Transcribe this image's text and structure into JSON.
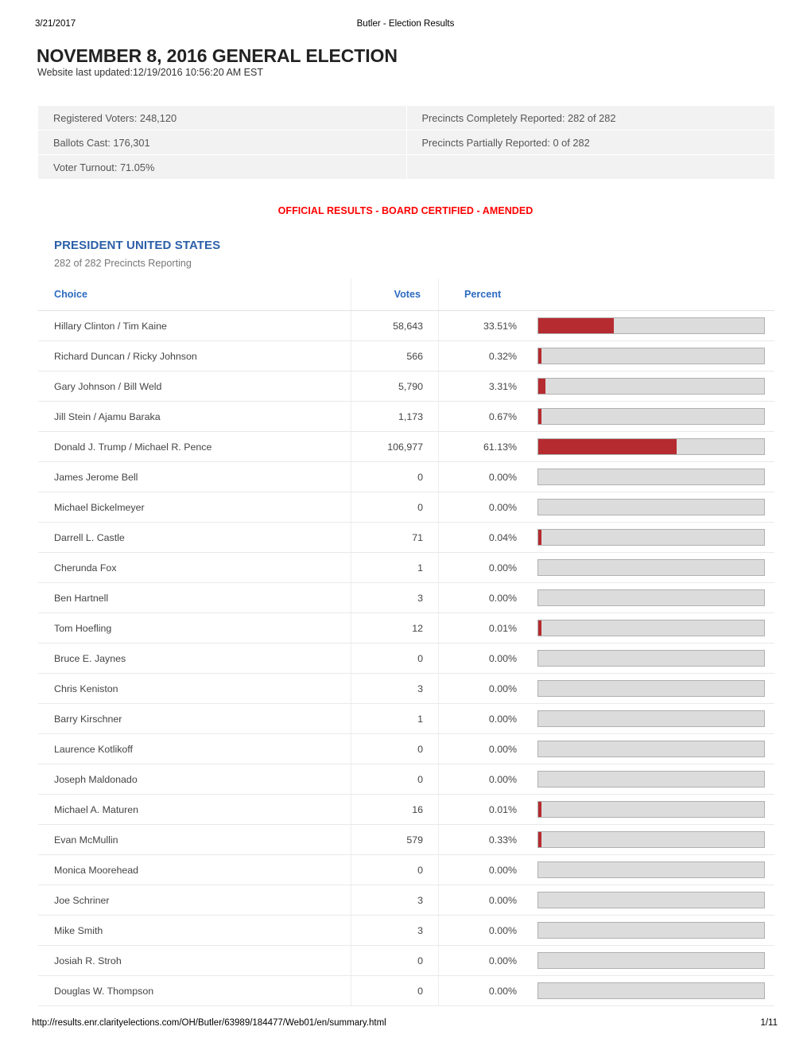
{
  "print_header": {
    "date": "3/21/2017",
    "title": "Butler - Election Results"
  },
  "document": {
    "title": "NOVEMBER 8, 2016 GENERAL ELECTION",
    "last_updated": "Website last updated:12/19/2016 10:56:20 AM EST"
  },
  "summary": {
    "cells": [
      "Registered Voters: 248,120",
      "Precincts Completely Reported: 282 of 282",
      "Ballots Cast: 176,301",
      "Precincts Partially Reported: 0 of 282",
      "Voter Turnout: 71.05%",
      ""
    ]
  },
  "banner": {
    "text": "OFFICIAL RESULTS - BOARD CERTIFIED - AMENDED",
    "color": "#ff0000"
  },
  "contest": {
    "title": "PRESIDENT UNITED STATES",
    "precincts_reporting": "282 of 282 Precincts Reporting",
    "title_color": "#2c5fa8"
  },
  "table": {
    "headers": {
      "choice": "Choice",
      "votes": "Votes",
      "percent": "Percent"
    },
    "bar_color": "#b52b30",
    "track_color": "#dcdcdc"
  },
  "chart_data": {
    "type": "bar",
    "title": "PRESIDENT UNITED STATES",
    "xlabel": "Percent",
    "ylabel": "Choice",
    "xlim": [
      0,
      100
    ],
    "grid": false,
    "legend": null,
    "categories": [
      "Hillary Clinton / Tim Kaine",
      "Richard Duncan / Ricky Johnson",
      "Gary Johnson / Bill Weld",
      "Jill Stein / Ajamu Baraka",
      "Donald J. Trump / Michael R. Pence",
      "James Jerome Bell",
      "Michael Bickelmeyer",
      "Darrell L. Castle",
      "Cherunda Fox",
      "Ben Hartnell",
      "Tom Hoefling",
      "Bruce E. Jaynes",
      "Chris Keniston",
      "Barry Kirschner",
      "Laurence Kotlikoff",
      "Joseph Maldonado",
      "Michael A. Maturen",
      "Evan McMullin",
      "Monica Moorehead",
      "Joe Schriner",
      "Mike Smith",
      "Josiah R. Stroh",
      "Douglas W. Thompson"
    ],
    "values": [
      33.51,
      0.32,
      3.31,
      0.67,
      61.13,
      0.0,
      0.0,
      0.04,
      0.0,
      0.0,
      0.01,
      0.0,
      0.0,
      0.0,
      0.0,
      0.0,
      0.01,
      0.33,
      0.0,
      0.0,
      0.0,
      0.0,
      0.0
    ],
    "votes": [
      58643,
      566,
      5790,
      1173,
      106977,
      0,
      0,
      71,
      1,
      3,
      12,
      0,
      3,
      1,
      0,
      0,
      16,
      579,
      0,
      3,
      3,
      0,
      0
    ]
  },
  "rows": [
    {
      "choice": "Hillary Clinton / Tim Kaine",
      "votes": "58,643",
      "percent": "33.51%",
      "pct": 33.51
    },
    {
      "choice": "Richard Duncan / Ricky Johnson",
      "votes": "566",
      "percent": "0.32%",
      "pct": 0.32
    },
    {
      "choice": "Gary Johnson / Bill Weld",
      "votes": "5,790",
      "percent": "3.31%",
      "pct": 3.31
    },
    {
      "choice": "Jill Stein / Ajamu Baraka",
      "votes": "1,173",
      "percent": "0.67%",
      "pct": 0.67
    },
    {
      "choice": "Donald J. Trump / Michael R. Pence",
      "votes": "106,977",
      "percent": "61.13%",
      "pct": 61.13
    },
    {
      "choice": "James Jerome Bell",
      "votes": "0",
      "percent": "0.00%",
      "pct": 0
    },
    {
      "choice": "Michael Bickelmeyer",
      "votes": "0",
      "percent": "0.00%",
      "pct": 0
    },
    {
      "choice": "Darrell L. Castle",
      "votes": "71",
      "percent": "0.04%",
      "pct": 0.04
    },
    {
      "choice": "Cherunda Fox",
      "votes": "1",
      "percent": "0.00%",
      "pct": 0
    },
    {
      "choice": "Ben Hartnell",
      "votes": "3",
      "percent": "0.00%",
      "pct": 0
    },
    {
      "choice": "Tom Hoefling",
      "votes": "12",
      "percent": "0.01%",
      "pct": 0.01
    },
    {
      "choice": "Bruce E. Jaynes",
      "votes": "0",
      "percent": "0.00%",
      "pct": 0
    },
    {
      "choice": "Chris Keniston",
      "votes": "3",
      "percent": "0.00%",
      "pct": 0
    },
    {
      "choice": "Barry Kirschner",
      "votes": "1",
      "percent": "0.00%",
      "pct": 0
    },
    {
      "choice": "Laurence Kotlikoff",
      "votes": "0",
      "percent": "0.00%",
      "pct": 0
    },
    {
      "choice": "Joseph Maldonado",
      "votes": "0",
      "percent": "0.00%",
      "pct": 0
    },
    {
      "choice": "Michael A. Maturen",
      "votes": "16",
      "percent": "0.01%",
      "pct": 0.01
    },
    {
      "choice": "Evan McMullin",
      "votes": "579",
      "percent": "0.33%",
      "pct": 0.33
    },
    {
      "choice": "Monica Moorehead",
      "votes": "0",
      "percent": "0.00%",
      "pct": 0
    },
    {
      "choice": "Joe Schriner",
      "votes": "3",
      "percent": "0.00%",
      "pct": 0
    },
    {
      "choice": "Mike Smith",
      "votes": "3",
      "percent": "0.00%",
      "pct": 0
    },
    {
      "choice": "Josiah R. Stroh",
      "votes": "0",
      "percent": "0.00%",
      "pct": 0
    },
    {
      "choice": "Douglas W. Thompson",
      "votes": "0",
      "percent": "0.00%",
      "pct": 0
    }
  ],
  "print_footer": {
    "url": "http://results.enr.clarityelections.com/OH/Butler/63989/184477/Web01/en/summary.html",
    "page": "1/11"
  }
}
